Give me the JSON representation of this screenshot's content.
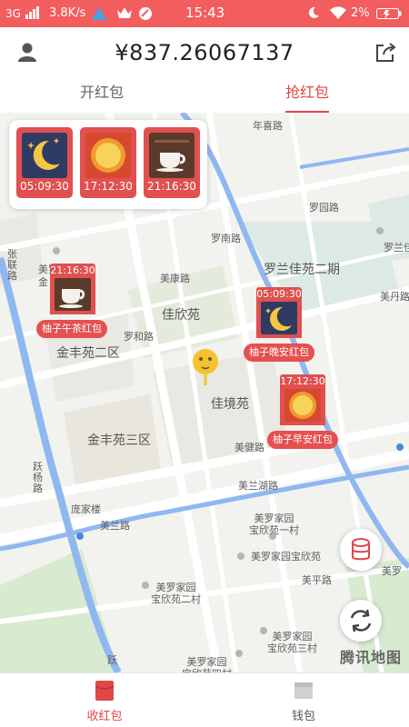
{
  "status_bar": {
    "network": "3G",
    "speed": "3.8K/s",
    "time": "15:43",
    "battery": "2%"
  },
  "header": {
    "balance": "¥837.26067137",
    "profile_icon": "user-icon",
    "share_icon": "share-icon"
  },
  "tabs": [
    {
      "label": "开红包",
      "active": false
    },
    {
      "label": "抢红包",
      "active": true
    }
  ],
  "envelope_card": [
    {
      "icon": "moon-icon",
      "time": "05:09:30"
    },
    {
      "icon": "sun-icon",
      "time": "17:12:30"
    },
    {
      "icon": "coffee-icon",
      "time": "21:16:30"
    }
  ],
  "map": {
    "labels": {
      "nianxi_road": "年喜路",
      "luo_yuan_road": "罗园路",
      "luolan_jiayuan_2": "罗兰佳苑二期",
      "luolan_short": "罗兰佳",
      "meidan_road": "美丹路",
      "meikang_road": "美康路",
      "luonan_road": "罗南路",
      "jiaxin_yuan": "佳欣苑",
      "luohe_road": "罗和路",
      "jinfeng_2": "金丰苑二区",
      "jiajing_yuan": "佳境苑",
      "jinfeng_3": "金丰苑三区",
      "meijian_road": "美健路",
      "meilan_lake_road": "美兰湖路",
      "meilan_road": "美兰路",
      "meiluo_jiayuan": "美罗家园",
      "jin_short": "金",
      "zhangli_road": "张联路",
      "yueyang_road": "跃杨路",
      "pangjia_lou": "庞家楼",
      "baoxin_1": "美罗家园\n宝欣苑一村",
      "baoxin_yuan": "美罗家园宝欣苑",
      "meiping_road": "美平路",
      "baoxin_2": "美罗家园\n宝欣苑二村",
      "baoxin_3": "美罗家园\n宝欣苑三村",
      "baoxin_4": "美罗家园\n宝欣苑四村",
      "meiluo_short": "美罗",
      "yue_short": "跃"
    },
    "pins": [
      {
        "time": "21:16:30",
        "icon": "coffee-icon",
        "label": "柚子午茶红包"
      },
      {
        "time": "05:09:30",
        "icon": "moon-icon",
        "label": "柚子晚安红包"
      },
      {
        "time": "17:12:30",
        "icon": "sun-icon",
        "label": "柚子早安红包"
      }
    ],
    "logo": "腾讯地图",
    "buttons": {
      "layer_icon": "database-icon",
      "refresh_icon": "refresh-icon"
    }
  },
  "bottom_nav": [
    {
      "label": "收红包",
      "active": true,
      "icon": "envelope-icon"
    },
    {
      "label": "钱包",
      "active": false,
      "icon": "wallet-icon"
    }
  ],
  "colors": {
    "accent": "#f25d5d",
    "envelope": "#e05050",
    "tab_active": "#e14747"
  }
}
